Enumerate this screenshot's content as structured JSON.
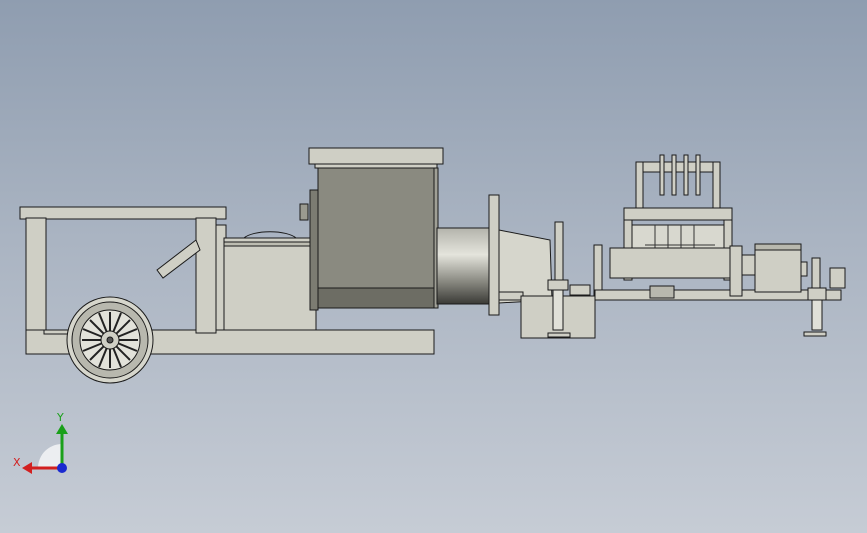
{
  "viewport": {
    "background_top": "#8f9db0",
    "background_bottom": "#c6ccd5",
    "part_fill": "#cfcfc5",
    "part_dark_fill": "#8a8a80",
    "edge_color": "#1a1a1a"
  },
  "model": {
    "description_visible": false
  },
  "triad": {
    "x_label": "X",
    "y_label": "Y",
    "x_color": "#d22020",
    "y_color": "#1aa01a",
    "z_color": "#1a2ad0"
  }
}
